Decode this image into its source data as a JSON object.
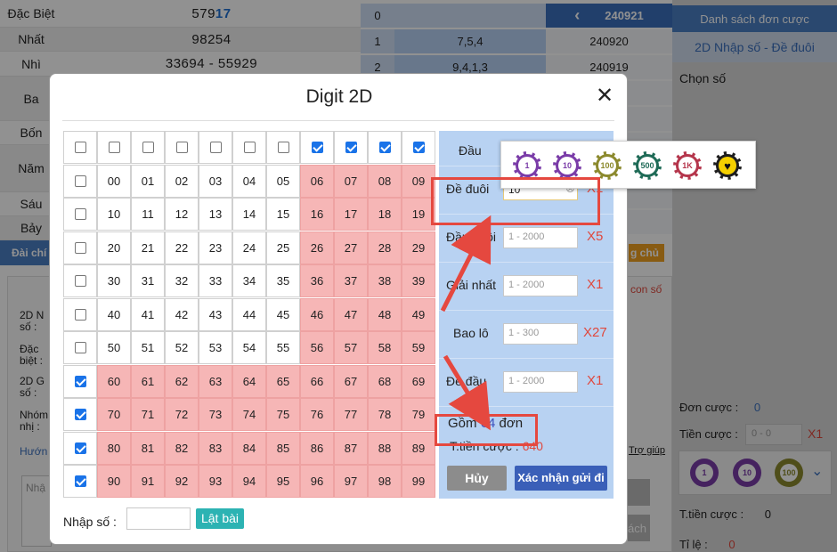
{
  "results": [
    {
      "label": "Đặc Biệt",
      "value_main": "579",
      "value_hl": "17"
    },
    {
      "label": "Nhất",
      "value_main": "98254",
      "value_hl": ""
    },
    {
      "label": "Nhì",
      "value_main": "33694 -  55929",
      "value_hl": ""
    },
    {
      "label": "Ba",
      "value_main": "",
      "value_hl": ""
    },
    {
      "label": "Bốn",
      "value_main": "",
      "value_hl": ""
    },
    {
      "label": "Năm",
      "value_main": "",
      "value_hl": ""
    },
    {
      "label": "Sáu",
      "value_main": "",
      "value_hl": ""
    },
    {
      "label": "Bảy",
      "value_main": "",
      "value_hl": ""
    }
  ],
  "mid_table": [
    {
      "idx": "0",
      "digits": "",
      "draw": "240921"
    },
    {
      "idx": "1",
      "digits": "7,5,4",
      "draw": "240920"
    },
    {
      "idx": "2",
      "digits": "9,4,1,3",
      "draw": "240919"
    }
  ],
  "mid_nav_icon": "chevron-left-icon",
  "right_panel": {
    "header": "Danh sách đơn cược",
    "subheader": "2D Nhập số - Đề đuôi",
    "choose": "Chọn số",
    "don_cuoc_label": "Đơn cược :",
    "don_cuoc_value": "0",
    "tien_cuoc_label": "Tiền cược :",
    "tien_cuoc_placeholder": "0 - 0",
    "tien_cuoc_mult": "X1",
    "ttien_label": "T.tiền cược :",
    "ttien_value": "0",
    "tile_label": "Tỉ lệ :",
    "tile_value": "0",
    "chips": [
      "1",
      "10",
      "100"
    ]
  },
  "background_left": {
    "dai_label": "Đài chí",
    "rows": [
      "2D N số :",
      "Đặc biệt :",
      "2D G số :",
      "Nhóm nhị :",
      "Hướn"
    ],
    "input_placeholder": "Nhậ",
    "trang_chu": "g chủ",
    "con_so": "con số",
    "tro_giup": "Trợ giúp",
    "xoa": "ách"
  },
  "modal": {
    "title": "Digit 2D",
    "close_icon": "close-icon",
    "column_checks": [
      false,
      false,
      false,
      false,
      false,
      false,
      false,
      true,
      true,
      true,
      true
    ],
    "row_checks": [
      false,
      false,
      false,
      false,
      false,
      false,
      true,
      true,
      true,
      true
    ],
    "selected_columns": [
      6,
      7,
      8,
      9
    ],
    "selected_rows": [
      6,
      7,
      8,
      9
    ],
    "grid_numbers": [
      [
        "00",
        "01",
        "02",
        "03",
        "04",
        "05",
        "06",
        "07",
        "08",
        "09"
      ],
      [
        "10",
        "11",
        "12",
        "13",
        "14",
        "15",
        "16",
        "17",
        "18",
        "19"
      ],
      [
        "20",
        "21",
        "22",
        "23",
        "24",
        "25",
        "26",
        "27",
        "28",
        "29"
      ],
      [
        "30",
        "31",
        "32",
        "33",
        "34",
        "35",
        "36",
        "37",
        "38",
        "39"
      ],
      [
        "40",
        "41",
        "42",
        "43",
        "44",
        "45",
        "46",
        "47",
        "48",
        "49"
      ],
      [
        "50",
        "51",
        "52",
        "53",
        "54",
        "55",
        "56",
        "57",
        "58",
        "59"
      ],
      [
        "60",
        "61",
        "62",
        "63",
        "64",
        "65",
        "66",
        "67",
        "68",
        "69"
      ],
      [
        "70",
        "71",
        "72",
        "73",
        "74",
        "75",
        "76",
        "77",
        "78",
        "79"
      ],
      [
        "80",
        "81",
        "82",
        "83",
        "84",
        "85",
        "86",
        "87",
        "88",
        "89"
      ],
      [
        "90",
        "91",
        "92",
        "93",
        "94",
        "95",
        "96",
        "97",
        "98",
        "99"
      ]
    ],
    "bet_types": [
      {
        "label": "Đầu",
        "placeholder": "",
        "mult": ""
      },
      {
        "label": "Đề đuôi",
        "value": "10",
        "placeholder": "",
        "mult": "X1"
      },
      {
        "label": "Đầu đuôi",
        "placeholder": "1 - 2000",
        "mult": "X5"
      },
      {
        "label": "Giải nhất",
        "placeholder": "1 - 2000",
        "mult": "X1"
      },
      {
        "label": "Bao lô",
        "placeholder": "1 - 300",
        "mult": "X27"
      },
      {
        "label": "Đề đầu",
        "placeholder": "1 - 2000",
        "mult": "X1"
      }
    ],
    "summary_prefix": "Gồm ",
    "summary_count": "64",
    "summary_suffix": " đơn",
    "total_label": "T.tiền cược : ",
    "total_value": "640",
    "cancel_label": "Hủy",
    "confirm_label": "Xác nhận gửi đi",
    "input_label": "Nhập số :",
    "input_value": "",
    "shuffle_label": "Lật bài"
  },
  "chip_bar": {
    "chips": [
      {
        "label": "1",
        "color": "#7a3ca8"
      },
      {
        "label": "10",
        "color": "#7a3ca8"
      },
      {
        "label": "100",
        "color": "#8c8a2e"
      },
      {
        "label": "500",
        "color": "#1f6b57"
      },
      {
        "label": "1K",
        "color": "#b5364c"
      },
      {
        "label": "heart",
        "color": "#1e1e1e"
      }
    ]
  },
  "colors": {
    "accent_blue": "#4a7fc4",
    "selected_cell": "#f6b6b6",
    "multiplier_red": "#e0483d",
    "annotation_red": "#e5483f"
  }
}
